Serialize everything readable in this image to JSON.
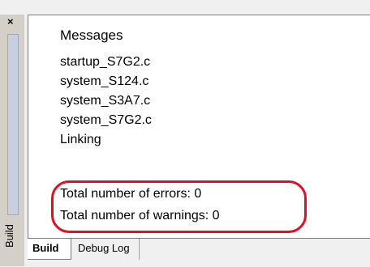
{
  "window": {
    "close_glyph": "×",
    "side_label": "Build"
  },
  "messages": {
    "header": "Messages",
    "lines": [
      "startup_S7G2.c",
      "system_S124.c",
      "system_S3A7.c",
      "system_S7G2.c",
      "Linking",
      "",
      "Total number of errors: 0",
      "Total number of warnings: 0"
    ]
  },
  "tabs": [
    {
      "label": "Build",
      "active": true
    },
    {
      "label": "Debug Log",
      "active": false
    }
  ],
  "colors": {
    "highlight_oval": "#e01020",
    "panel_bg": "#ffffff",
    "frame_bg": "#f0f0f0"
  }
}
